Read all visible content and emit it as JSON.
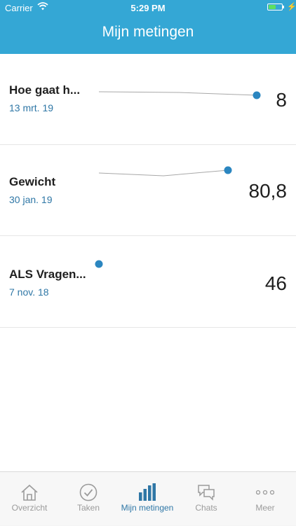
{
  "status_bar": {
    "carrier": "Carrier",
    "time": "5:29 PM",
    "battery_level": 0.55
  },
  "header": {
    "title": "Mijn metingen"
  },
  "measurements": [
    {
      "name": "Hoe gaat h...",
      "date": "13 mrt. 19",
      "value": "8"
    },
    {
      "name": "Gewicht",
      "date": "30 jan. 19",
      "value": "80,8"
    },
    {
      "name": "ALS Vragen...",
      "date": "7 nov. 18",
      "value": "46"
    }
  ],
  "tabs": [
    {
      "label": "Overzicht",
      "icon": "home-icon"
    },
    {
      "label": "Taken",
      "icon": "check-circle-icon"
    },
    {
      "label": "Mijn metingen",
      "icon": "bar-chart-icon",
      "active": true
    },
    {
      "label": "Chats",
      "icon": "chat-bubbles-icon"
    },
    {
      "label": "Meer",
      "icon": "more-dots-icon"
    }
  ],
  "colors": {
    "header": "#34a7d5",
    "accent": "#2f77a6",
    "sparkline_dot": "#2b86c0"
  }
}
